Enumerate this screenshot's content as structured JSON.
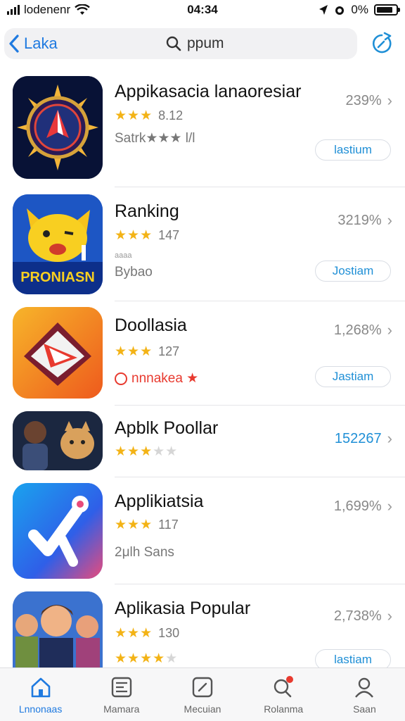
{
  "status_bar": {
    "carrier": "lodenenr",
    "time": "04:34",
    "battery": "0%",
    "battery_level": 0.85
  },
  "nav": {
    "back_label": "Laka",
    "search_text": "ppum"
  },
  "apps": [
    {
      "name": "Appikasacia lanaoresiar",
      "rating_text": "8.12",
      "stars": 3,
      "sub": "Satrk★★★ l/l",
      "stat": "239%",
      "button": "lastium",
      "stat_blue": false
    },
    {
      "name": "Ranking",
      "rating_text": "147",
      "stars": 3,
      "sub": "Bybao",
      "sub_above": "aaaa",
      "stat": "3219%",
      "button": "Jostiam",
      "stat_blue": false
    },
    {
      "name": "Doollasia",
      "rating_text": "127",
      "stars": 3,
      "sub": "nnnakea ★",
      "stat": "1,268%",
      "button": "Jastiam",
      "stat_blue": false
    },
    {
      "name": "Apblk Poollar",
      "rating_text": "",
      "stars": 3,
      "sub": "",
      "stat": "152267",
      "button": "",
      "stat_blue": true
    },
    {
      "name": "Applikiatsia",
      "rating_text": "117",
      "stars": 3,
      "sub": "2μlh Sans",
      "stat": "1,699%",
      "button": "",
      "stat_blue": false
    },
    {
      "name": "Aplikasia Popular",
      "rating_text": "130",
      "stars": 3,
      "sub": "",
      "stat": "2,738%",
      "button": "lastiam",
      "stat_blue": false
    }
  ],
  "tabs": [
    {
      "label": "Lnnonaas",
      "icon": "home-icon",
      "active": true
    },
    {
      "label": "Mamara",
      "icon": "gallery-icon",
      "active": false
    },
    {
      "label": "Mecuian",
      "icon": "screen-icon",
      "active": false
    },
    {
      "label": "Rolanma",
      "icon": "search-icon",
      "active": false
    },
    {
      "label": "Saan",
      "icon": "person-icon",
      "active": false
    }
  ],
  "colors": {
    "accent": "#1f7ae0",
    "star": "#f3b316",
    "badge": "#e83a2f"
  }
}
